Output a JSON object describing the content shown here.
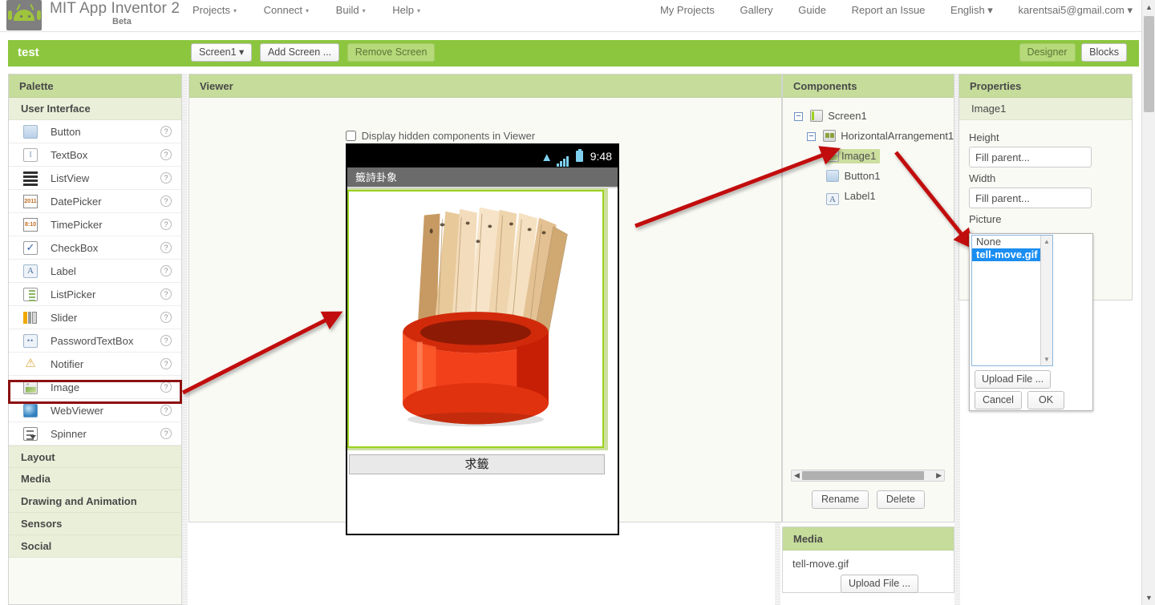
{
  "topbar": {
    "brand": "MIT App Inventor 2",
    "beta": "Beta",
    "nav": [
      {
        "label": "Projects",
        "caret": "▾"
      },
      {
        "label": "Connect",
        "caret": "▾"
      },
      {
        "label": "Build",
        "caret": "▾"
      },
      {
        "label": "Help",
        "caret": "▾"
      }
    ],
    "right": [
      {
        "label": "My Projects"
      },
      {
        "label": "Gallery"
      },
      {
        "label": "Guide"
      },
      {
        "label": "Report an Issue"
      },
      {
        "label": "English ▾"
      },
      {
        "label": "karentsai5@gmail.com ▾"
      }
    ]
  },
  "projectbar": {
    "title": "test",
    "screen_select": "Screen1 ▾",
    "add_screen": "Add Screen ...",
    "remove_screen": "Remove Screen",
    "designer": "Designer",
    "blocks": "Blocks"
  },
  "palette": {
    "header": "Palette",
    "sections": [
      {
        "label": "User Interface",
        "open": true
      },
      {
        "label": "Layout",
        "open": false
      },
      {
        "label": "Media",
        "open": false
      },
      {
        "label": "Drawing and Animation",
        "open": false
      },
      {
        "label": "Sensors",
        "open": false
      },
      {
        "label": "Social",
        "open": false
      }
    ],
    "items": [
      {
        "label": "Button",
        "icon": "button-icon",
        "help": "?"
      },
      {
        "label": "TextBox",
        "icon": "textbox-icon",
        "help": "?"
      },
      {
        "label": "ListView",
        "icon": "listview-icon",
        "help": "?"
      },
      {
        "label": "DatePicker",
        "icon": "datepicker-icon",
        "help": "?"
      },
      {
        "label": "TimePicker",
        "icon": "timepicker-icon",
        "help": "?"
      },
      {
        "label": "CheckBox",
        "icon": "checkbox-icon",
        "help": "?"
      },
      {
        "label": "Label",
        "icon": "label-icon",
        "help": "?"
      },
      {
        "label": "ListPicker",
        "icon": "listpicker-icon",
        "help": "?"
      },
      {
        "label": "Slider",
        "icon": "slider-icon",
        "help": "?"
      },
      {
        "label": "PasswordTextBox",
        "icon": "password-icon",
        "help": "?"
      },
      {
        "label": "Notifier",
        "icon": "notifier-icon",
        "help": "?"
      },
      {
        "label": "Image",
        "icon": "image-icon",
        "help": "?"
      },
      {
        "label": "WebViewer",
        "icon": "webviewer-icon",
        "help": "?"
      },
      {
        "label": "Spinner",
        "icon": "spinner-icon",
        "help": "?"
      }
    ]
  },
  "viewer": {
    "header": "Viewer",
    "hidden_components_label": "Display hidden components in Viewer",
    "hidden_components_checked": false,
    "phone": {
      "status_time": "9:48",
      "title": "籤詩卦象",
      "button_label": "求籤"
    }
  },
  "components": {
    "header": "Components",
    "tree": [
      {
        "label": "Screen1",
        "icon": "screen-icon",
        "depth": 0,
        "toggle": "−",
        "selected": false
      },
      {
        "label": "HorizontalArrangement1",
        "icon": "horizontal-arrangement-icon",
        "depth": 1,
        "toggle": "−",
        "selected": false
      },
      {
        "label": "Image1",
        "icon": "image-icon",
        "depth": 2,
        "toggle": "",
        "selected": true
      },
      {
        "label": "Button1",
        "icon": "button-icon",
        "depth": 2,
        "toggle": "",
        "selected": false
      },
      {
        "label": "Label1",
        "icon": "label-icon",
        "depth": 2,
        "toggle": "",
        "selected": false
      }
    ],
    "rename": "Rename",
    "delete": "Delete"
  },
  "media": {
    "header": "Media",
    "files": [
      "tell-move.gif"
    ],
    "upload": "Upload File ..."
  },
  "properties": {
    "header": "Properties",
    "component": "Image1",
    "fields": [
      {
        "label": "Height",
        "value": "Fill parent..."
      },
      {
        "label": "Width",
        "value": "Fill parent..."
      }
    ],
    "picture_label": "Picture",
    "picture_value": "None",
    "picture_popup": {
      "options": [
        {
          "label": "None",
          "selected": false
        },
        {
          "label": "tell-move.gif",
          "selected": true
        }
      ],
      "upload": "Upload File ...",
      "cancel": "Cancel",
      "ok": "OK"
    }
  },
  "colors": {
    "brand_green": "#8cc63e",
    "panel_header": "#c5dc9b",
    "subhead": "#eaefd9",
    "selection": "#1b8ef2",
    "annotation_red": "#8c1111",
    "arrow_red": "#c10f0f"
  }
}
